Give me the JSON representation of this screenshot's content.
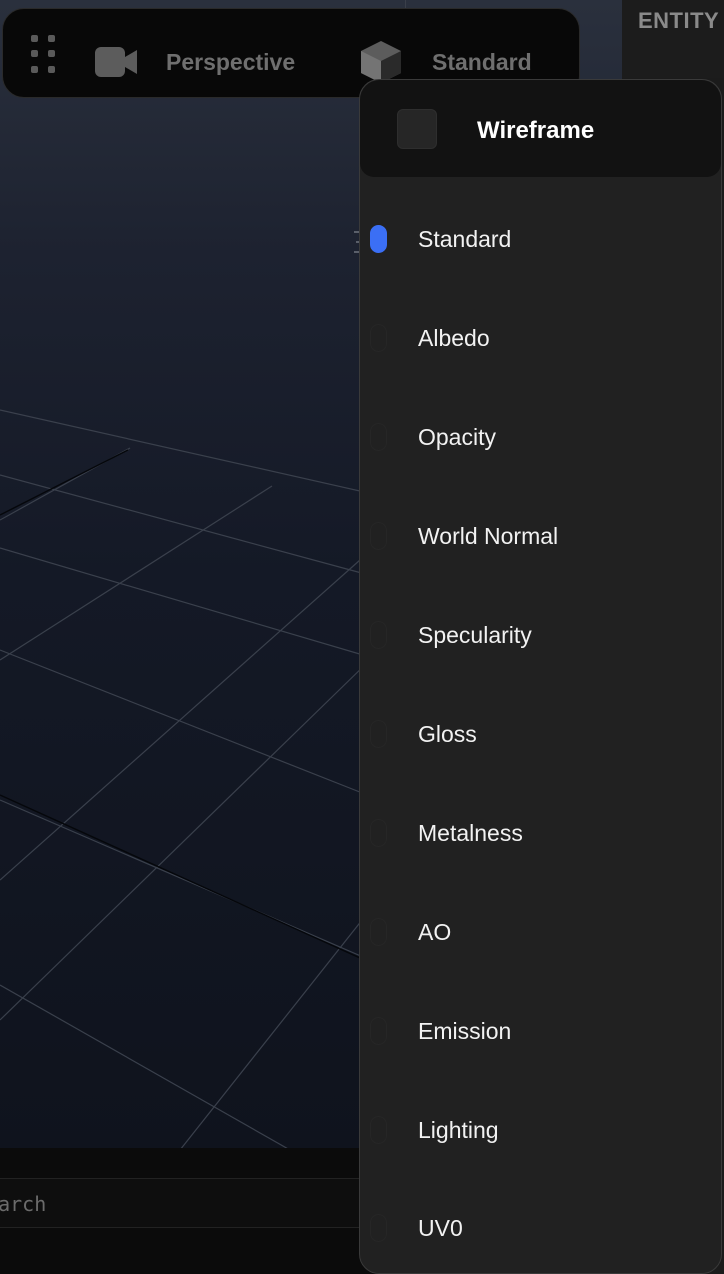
{
  "toolbar": {
    "camera_label": "Perspective",
    "render_mode_label": "Standard"
  },
  "right_panel": {
    "title": "ENTITY"
  },
  "search": {
    "placeholder": "Search"
  },
  "dropdown": {
    "wireframe": {
      "label": "Wireframe",
      "checked": false
    },
    "selected": "Standard",
    "items": [
      {
        "label": "Standard",
        "selected": true
      },
      {
        "label": "Albedo",
        "selected": false
      },
      {
        "label": "Opacity",
        "selected": false
      },
      {
        "label": "World Normal",
        "selected": false
      },
      {
        "label": "Specularity",
        "selected": false
      },
      {
        "label": "Gloss",
        "selected": false
      },
      {
        "label": "Metalness",
        "selected": false
      },
      {
        "label": "AO",
        "selected": false
      },
      {
        "label": "Emission",
        "selected": false
      },
      {
        "label": "Lighting",
        "selected": false
      },
      {
        "label": "UV0",
        "selected": false
      }
    ]
  },
  "colors": {
    "accent": "#3b6ff5",
    "menu_bg": "#212121",
    "toolbar_bg": "#080808"
  }
}
